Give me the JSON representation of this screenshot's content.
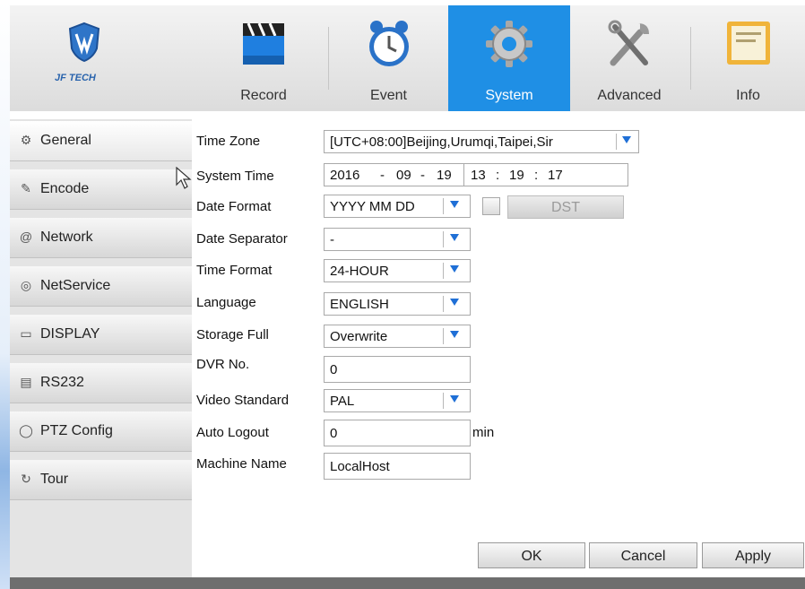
{
  "app": {
    "logo_text": "JF TECH",
    "accent_color": "#1f8fe5"
  },
  "tabs": [
    {
      "label": "Record",
      "icon": "clapperboard-icon"
    },
    {
      "label": "Event",
      "icon": "alarm-clock-icon"
    },
    {
      "label": "System",
      "icon": "gear-icon",
      "active": true
    },
    {
      "label": "Advanced",
      "icon": "tools-icon"
    },
    {
      "label": "Info",
      "icon": "info-document-icon"
    }
  ],
  "sidebar": {
    "items": [
      {
        "label": "General",
        "icon": "settings-icon",
        "active": true
      },
      {
        "label": "Encode",
        "icon": "edit-icon"
      },
      {
        "label": "Network",
        "icon": "at-icon"
      },
      {
        "label": "NetService",
        "icon": "globe-icon"
      },
      {
        "label": "DISPLAY",
        "icon": "monitor-icon"
      },
      {
        "label": "RS232",
        "icon": "serial-port-icon"
      },
      {
        "label": "PTZ Config",
        "icon": "ptz-camera-icon"
      },
      {
        "label": "Tour",
        "icon": "refresh-icon"
      }
    ]
  },
  "form": {
    "time_zone": {
      "label": "Time Zone",
      "value": "[UTC+08:00]Beijing,Urumqi,Taipei,Sir"
    },
    "system_time": {
      "label": "System Time",
      "year": "2016",
      "month": "09",
      "day": "19",
      "hour": "13",
      "minute": "19",
      "second": "17",
      "date_sep": "-",
      "time_sep": ":"
    },
    "date_format": {
      "label": "Date Format",
      "value": "YYYY MM DD",
      "dst_label": "DST"
    },
    "date_separator": {
      "label": "Date Separator",
      "value": "-"
    },
    "time_format": {
      "label": "Time Format",
      "value": "24-HOUR"
    },
    "language": {
      "label": "Language",
      "value": "ENGLISH"
    },
    "storage_full": {
      "label": "Storage Full",
      "value": "Overwrite"
    },
    "dvr_no": {
      "label": "DVR No.",
      "value": "0"
    },
    "video_standard": {
      "label": "Video Standard",
      "value": "PAL"
    },
    "auto_logout": {
      "label": "Auto Logout",
      "value": "0",
      "unit": "min"
    },
    "machine_name": {
      "label": "Machine Name",
      "value": "LocalHost"
    }
  },
  "buttons": {
    "ok": "OK",
    "cancel": "Cancel",
    "apply": "Apply"
  }
}
